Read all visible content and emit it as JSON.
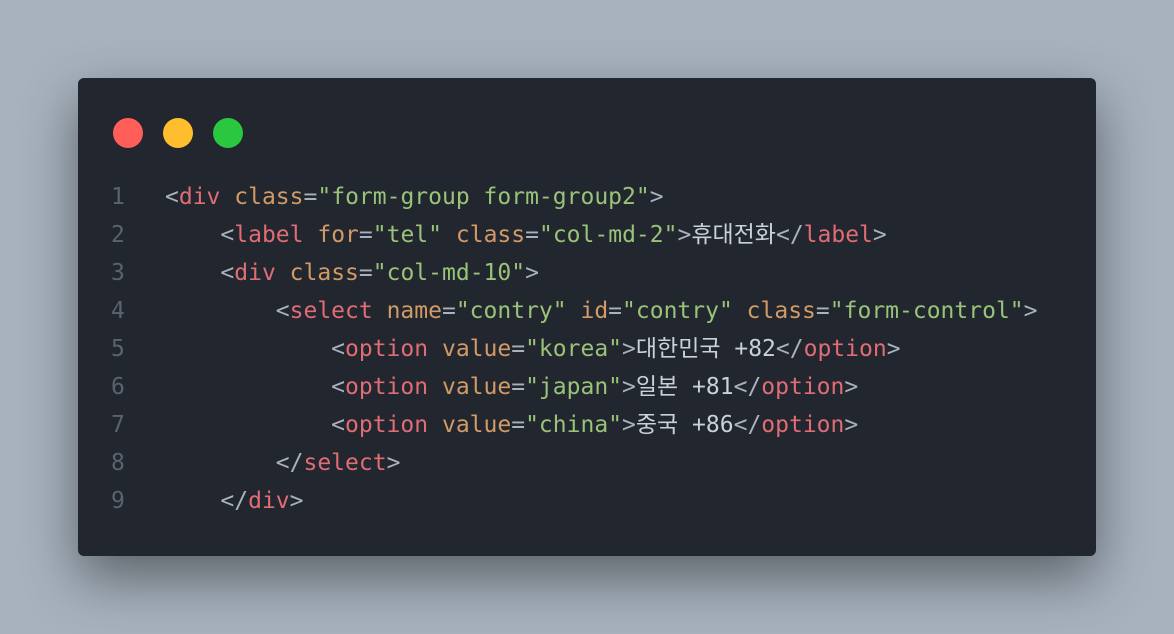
{
  "window": {
    "controls": {
      "close_color": "#ff5f58",
      "minimize_color": "#ffbe2e",
      "maximize_color": "#29c840"
    }
  },
  "code": {
    "language": "html",
    "lines": [
      {
        "number": "1",
        "tokens": [
          {
            "t": "punc",
            "v": "<"
          },
          {
            "t": "tag",
            "v": "div"
          },
          {
            "t": "punc",
            "v": " "
          },
          {
            "t": "attr",
            "v": "class"
          },
          {
            "t": "punc",
            "v": "="
          },
          {
            "t": "str",
            "v": "\"form-group form-group2\""
          },
          {
            "t": "punc",
            "v": ">"
          }
        ]
      },
      {
        "number": "2",
        "tokens": [
          {
            "t": "punc",
            "v": "    <"
          },
          {
            "t": "tag",
            "v": "label"
          },
          {
            "t": "punc",
            "v": " "
          },
          {
            "t": "attr",
            "v": "for"
          },
          {
            "t": "punc",
            "v": "="
          },
          {
            "t": "str",
            "v": "\"tel\""
          },
          {
            "t": "punc",
            "v": " "
          },
          {
            "t": "attr",
            "v": "class"
          },
          {
            "t": "punc",
            "v": "="
          },
          {
            "t": "str",
            "v": "\"col-md-2\""
          },
          {
            "t": "punc",
            "v": ">"
          },
          {
            "t": "txt",
            "v": "휴대전화"
          },
          {
            "t": "punc",
            "v": "</"
          },
          {
            "t": "tag",
            "v": "label"
          },
          {
            "t": "punc",
            "v": ">"
          }
        ]
      },
      {
        "number": "3",
        "tokens": [
          {
            "t": "punc",
            "v": "    <"
          },
          {
            "t": "tag",
            "v": "div"
          },
          {
            "t": "punc",
            "v": " "
          },
          {
            "t": "attr",
            "v": "class"
          },
          {
            "t": "punc",
            "v": "="
          },
          {
            "t": "str",
            "v": "\"col-md-10\""
          },
          {
            "t": "punc",
            "v": ">"
          }
        ]
      },
      {
        "number": "4",
        "tokens": [
          {
            "t": "punc",
            "v": "        <"
          },
          {
            "t": "tag",
            "v": "select"
          },
          {
            "t": "punc",
            "v": " "
          },
          {
            "t": "attr",
            "v": "name"
          },
          {
            "t": "punc",
            "v": "="
          },
          {
            "t": "str",
            "v": "\"contry\""
          },
          {
            "t": "punc",
            "v": " "
          },
          {
            "t": "attr",
            "v": "id"
          },
          {
            "t": "punc",
            "v": "="
          },
          {
            "t": "str",
            "v": "\"contry\""
          },
          {
            "t": "punc",
            "v": " "
          },
          {
            "t": "attr",
            "v": "class"
          },
          {
            "t": "punc",
            "v": "="
          },
          {
            "t": "str",
            "v": "\"form-control\""
          },
          {
            "t": "punc",
            "v": ">"
          }
        ]
      },
      {
        "number": "5",
        "tokens": [
          {
            "t": "punc",
            "v": "            <"
          },
          {
            "t": "tag",
            "v": "option"
          },
          {
            "t": "punc",
            "v": " "
          },
          {
            "t": "attr",
            "v": "value"
          },
          {
            "t": "punc",
            "v": "="
          },
          {
            "t": "str",
            "v": "\"korea\""
          },
          {
            "t": "punc",
            "v": ">"
          },
          {
            "t": "txt",
            "v": "대한민국 +82"
          },
          {
            "t": "punc",
            "v": "</"
          },
          {
            "t": "tag",
            "v": "option"
          },
          {
            "t": "punc",
            "v": ">"
          }
        ]
      },
      {
        "number": "6",
        "tokens": [
          {
            "t": "punc",
            "v": "            <"
          },
          {
            "t": "tag",
            "v": "option"
          },
          {
            "t": "punc",
            "v": " "
          },
          {
            "t": "attr",
            "v": "value"
          },
          {
            "t": "punc",
            "v": "="
          },
          {
            "t": "str",
            "v": "\"japan\""
          },
          {
            "t": "punc",
            "v": ">"
          },
          {
            "t": "txt",
            "v": "일본 +81"
          },
          {
            "t": "punc",
            "v": "</"
          },
          {
            "t": "tag",
            "v": "option"
          },
          {
            "t": "punc",
            "v": ">"
          }
        ]
      },
      {
        "number": "7",
        "tokens": [
          {
            "t": "punc",
            "v": "            <"
          },
          {
            "t": "tag",
            "v": "option"
          },
          {
            "t": "punc",
            "v": " "
          },
          {
            "t": "attr",
            "v": "value"
          },
          {
            "t": "punc",
            "v": "="
          },
          {
            "t": "str",
            "v": "\"china\""
          },
          {
            "t": "punc",
            "v": ">"
          },
          {
            "t": "txt",
            "v": "중국 +86"
          },
          {
            "t": "punc",
            "v": "</"
          },
          {
            "t": "tag",
            "v": "option"
          },
          {
            "t": "punc",
            "v": ">"
          }
        ]
      },
      {
        "number": "8",
        "tokens": [
          {
            "t": "punc",
            "v": "        </"
          },
          {
            "t": "tag",
            "v": "select"
          },
          {
            "t": "punc",
            "v": ">"
          }
        ]
      },
      {
        "number": "9",
        "tokens": [
          {
            "t": "punc",
            "v": "    </"
          },
          {
            "t": "tag",
            "v": "div"
          },
          {
            "t": "punc",
            "v": ">"
          }
        ]
      }
    ]
  }
}
